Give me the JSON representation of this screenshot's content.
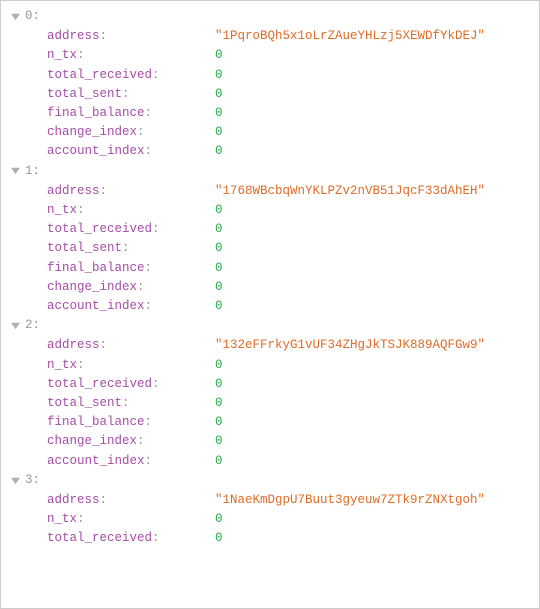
{
  "items": [
    {
      "index": "0",
      "fields": [
        {
          "key": "address",
          "value": "\"1PqroBQh5x1oLrZAueYHLzj5XEWDfYkDEJ\"",
          "type": "str"
        },
        {
          "key": "n_tx",
          "value": "0",
          "type": "num"
        },
        {
          "key": "total_received",
          "value": "0",
          "type": "num"
        },
        {
          "key": "total_sent",
          "value": "0",
          "type": "num"
        },
        {
          "key": "final_balance",
          "value": "0",
          "type": "num"
        },
        {
          "key": "change_index",
          "value": "0",
          "type": "num"
        },
        {
          "key": "account_index",
          "value": "0",
          "type": "num"
        }
      ]
    },
    {
      "index": "1",
      "fields": [
        {
          "key": "address",
          "value": "\"1768WBcbqWnYKLPZv2nVB51JqcF33dAhEH\"",
          "type": "str"
        },
        {
          "key": "n_tx",
          "value": "0",
          "type": "num"
        },
        {
          "key": "total_received",
          "value": "0",
          "type": "num"
        },
        {
          "key": "total_sent",
          "value": "0",
          "type": "num"
        },
        {
          "key": "final_balance",
          "value": "0",
          "type": "num"
        },
        {
          "key": "change_index",
          "value": "0",
          "type": "num"
        },
        {
          "key": "account_index",
          "value": "0",
          "type": "num"
        }
      ]
    },
    {
      "index": "2",
      "fields": [
        {
          "key": "address",
          "value": "\"132eFFrkyG1vUF34ZHgJkTSJK889AQFGw9\"",
          "type": "str"
        },
        {
          "key": "n_tx",
          "value": "0",
          "type": "num"
        },
        {
          "key": "total_received",
          "value": "0",
          "type": "num"
        },
        {
          "key": "total_sent",
          "value": "0",
          "type": "num"
        },
        {
          "key": "final_balance",
          "value": "0",
          "type": "num"
        },
        {
          "key": "change_index",
          "value": "0",
          "type": "num"
        },
        {
          "key": "account_index",
          "value": "0",
          "type": "num"
        }
      ]
    },
    {
      "index": "3",
      "fields": [
        {
          "key": "address",
          "value": "\"1NaeKmDgpU7Buut3gyeuw7ZTk9rZNXtgoh\"",
          "type": "str"
        },
        {
          "key": "n_tx",
          "value": "0",
          "type": "num"
        },
        {
          "key": "total_received",
          "value": "0",
          "type": "num"
        }
      ]
    }
  ]
}
